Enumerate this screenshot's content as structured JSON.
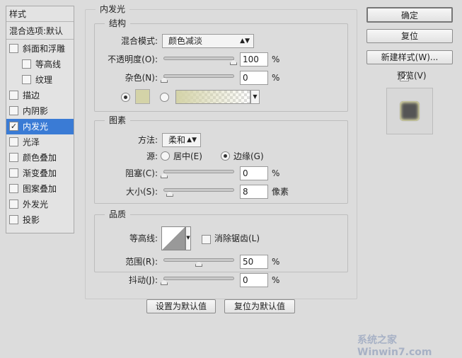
{
  "sidebar": {
    "header": "样式",
    "blend": "混合选项:默认",
    "items": [
      {
        "label": "斜面和浮雕",
        "checked": false,
        "indent": false
      },
      {
        "label": "等高线",
        "checked": false,
        "indent": true
      },
      {
        "label": "纹理",
        "checked": false,
        "indent": true
      },
      {
        "label": "描边",
        "checked": false,
        "indent": false
      },
      {
        "label": "内阴影",
        "checked": false,
        "indent": false
      },
      {
        "label": "内发光",
        "checked": true,
        "indent": false,
        "selected": true
      },
      {
        "label": "光泽",
        "checked": false,
        "indent": false
      },
      {
        "label": "颜色叠加",
        "checked": false,
        "indent": false
      },
      {
        "label": "渐变叠加",
        "checked": false,
        "indent": false
      },
      {
        "label": "图案叠加",
        "checked": false,
        "indent": false
      },
      {
        "label": "外发光",
        "checked": false,
        "indent": false
      },
      {
        "label": "投影",
        "checked": false,
        "indent": false
      }
    ]
  },
  "main": {
    "title": "内发光",
    "structure": {
      "title": "结构",
      "blend_label": "混合模式:",
      "blend_value": "颜色减淡",
      "opacity_label": "不透明度(O):",
      "opacity": "100",
      "noise_label": "杂色(N):",
      "noise": "0",
      "unit": "%",
      "glow_color": "#d4d3a8"
    },
    "elements": {
      "title": "图素",
      "method_label": "方法:",
      "method_value": "柔和",
      "source_label": "源:",
      "source_center": "居中(E)",
      "source_edge": "边缘(G)",
      "choke_label": "阻塞(C):",
      "choke": "0",
      "size_label": "大小(S):",
      "size": "8",
      "size_unit": "像素",
      "unit": "%"
    },
    "quality": {
      "title": "品质",
      "contour_label": "等高线:",
      "antialias_label": "消除锯齿(L)",
      "range_label": "范围(R):",
      "range": "50",
      "jitter_label": "抖动(J):",
      "jitter": "0",
      "unit": "%"
    },
    "make_default": "设置为默认值",
    "reset_default": "复位为默认值"
  },
  "buttons": {
    "ok": "确定",
    "reset": "复位",
    "new_style": "新建样式(W)...",
    "preview": "预览(V)"
  },
  "watermark": "系统之家 Winwin7.com"
}
